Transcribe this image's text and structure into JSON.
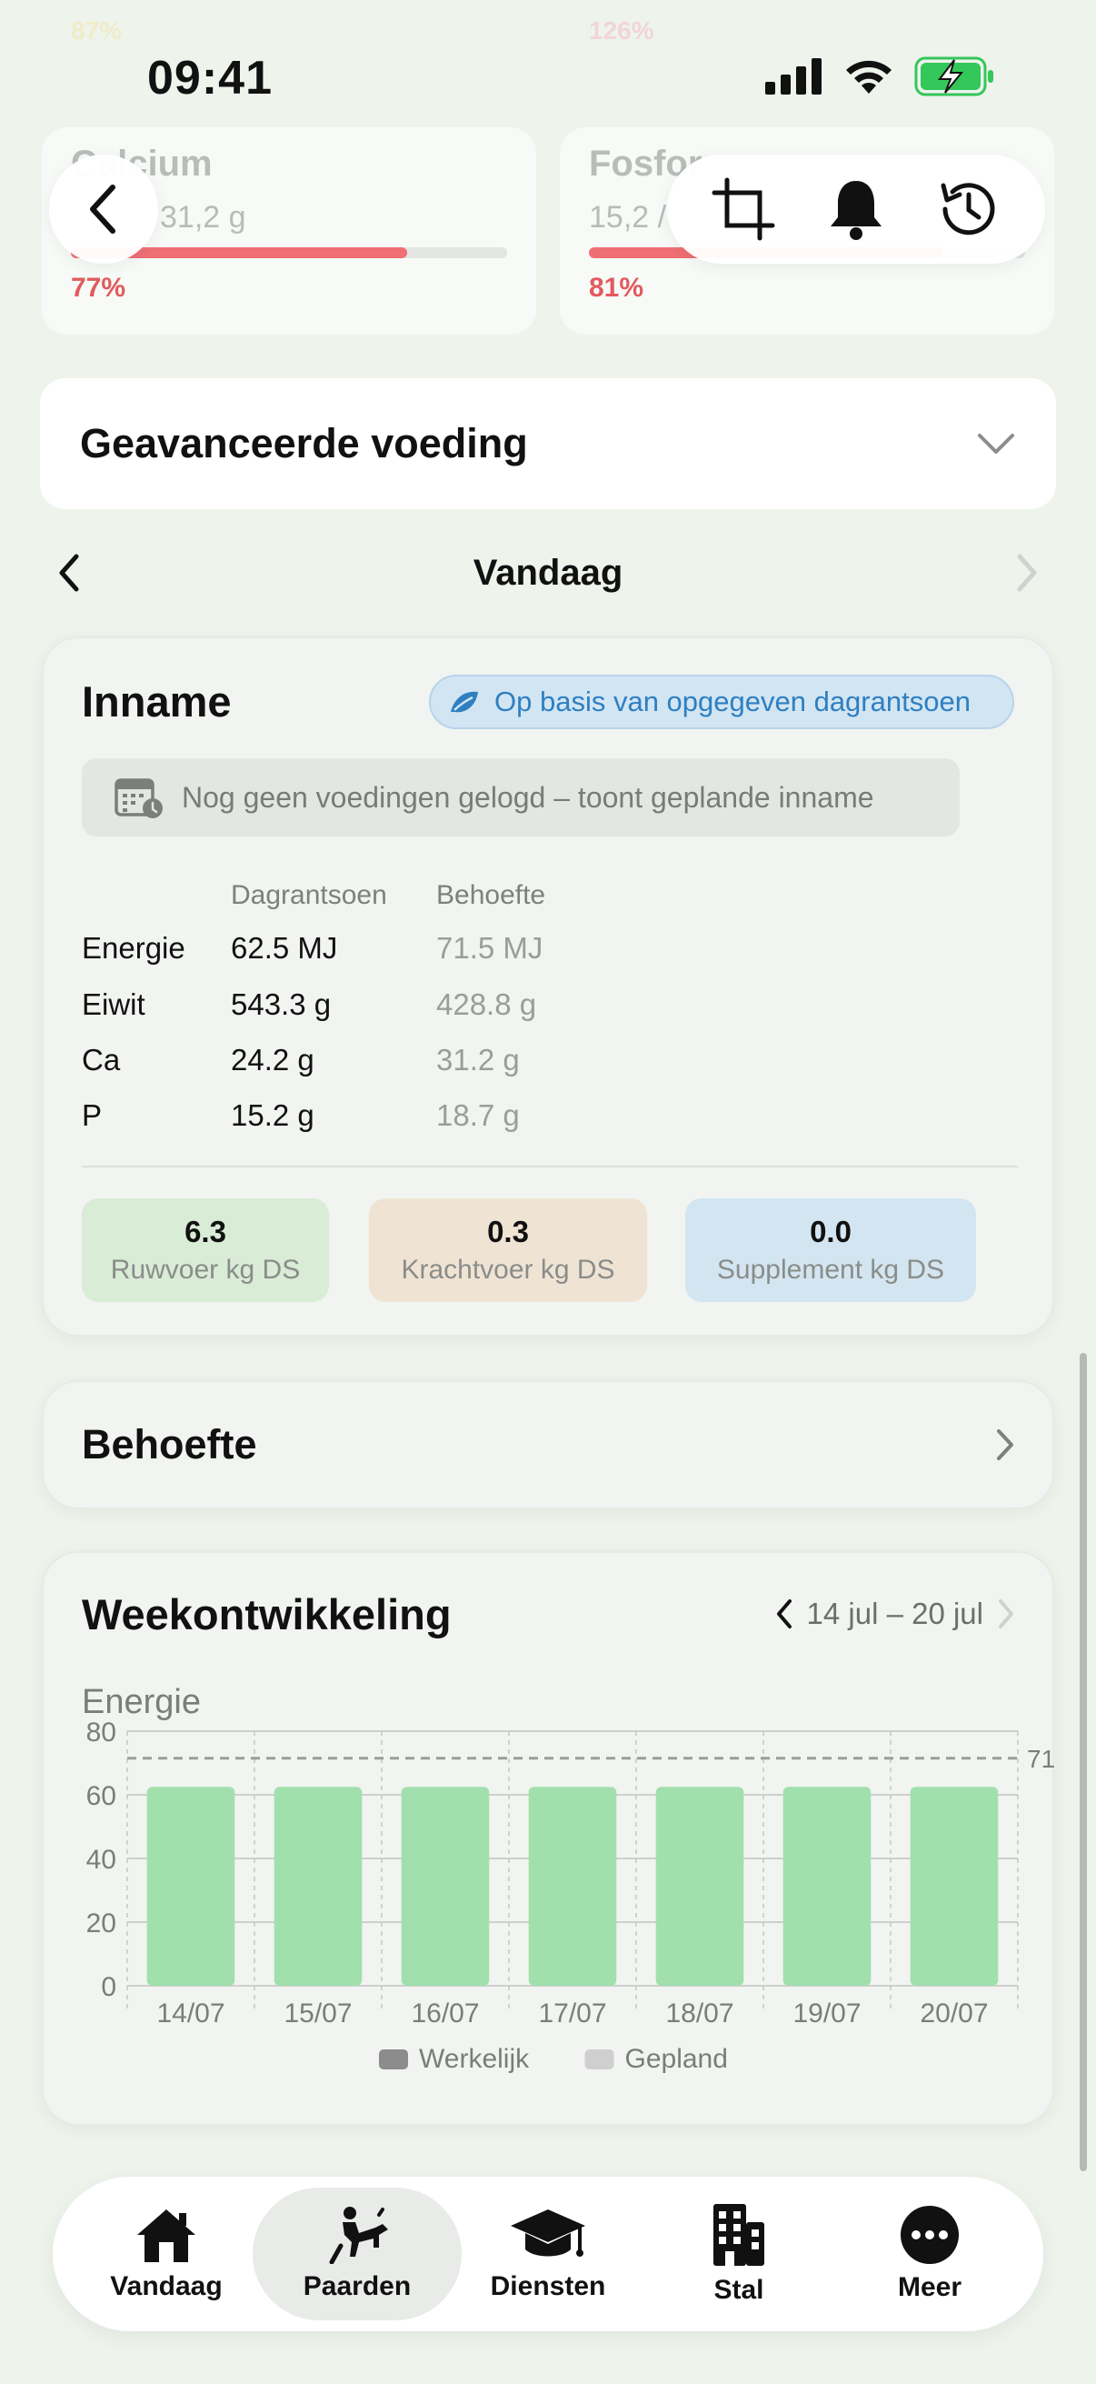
{
  "status": {
    "time": "09:41"
  },
  "top_cards_faded": {
    "left_pct": "87%",
    "right_pct": "126%"
  },
  "nutrients": [
    {
      "name": "Calcium",
      "value": "31,2 g",
      "pct": "77%",
      "fill": 0.77
    },
    {
      "name": "Fosfor",
      "value": "15,2 /",
      "pct": "81%",
      "fill": 0.81
    }
  ],
  "toolbar": {
    "back": "back",
    "crop": "crop",
    "notifications": "notifications",
    "history": "history"
  },
  "advanced": {
    "title": "Geavanceerde voeding"
  },
  "day_nav": {
    "label": "Vandaag"
  },
  "inname": {
    "title": "Inname",
    "badge": "Op basis van opgegeven dagrantsoen",
    "notice": "Nog geen voedingen gelogd – toont geplande inname",
    "columns": [
      "Dagrantsoen",
      "Behoefte"
    ],
    "rows": [
      {
        "label": "Energie",
        "ration": "62.5 MJ",
        "need": "71.5 MJ"
      },
      {
        "label": "Eiwit",
        "ration": "543.3 g",
        "need": "428.8 g"
      },
      {
        "label": "Ca",
        "ration": "24.2 g",
        "need": "31.2 g"
      },
      {
        "label": "P",
        "ration": "15.2 g",
        "need": "18.7 g"
      }
    ],
    "boxes": [
      {
        "value": "6.3",
        "label": "Ruwvoer kg DS",
        "color": "#d9ecd6"
      },
      {
        "value": "0.3",
        "label": "Krachtvoer kg DS",
        "color": "#efe3d4"
      },
      {
        "value": "0.0",
        "label": "Supplement kg DS",
        "color": "#d3e5f0"
      }
    ]
  },
  "behoefte": {
    "title": "Behoefte"
  },
  "week": {
    "title": "Weekontwikkeling",
    "range": "14 jul – 20 jul"
  },
  "chart_data": {
    "type": "bar",
    "title": "Energie",
    "categories": [
      "14/07",
      "15/07",
      "16/07",
      "17/07",
      "18/07",
      "19/07",
      "20/07"
    ],
    "series": [
      {
        "name": "Gepland",
        "values": [
          62.5,
          62.5,
          62.5,
          62.5,
          62.5,
          62.5,
          62.5
        ],
        "color": "#a1e0ad"
      }
    ],
    "reference_line": {
      "value": 71.5,
      "label": "71"
    },
    "ylim": [
      0,
      80
    ],
    "yticks": [
      0,
      20,
      40,
      60,
      80
    ],
    "legend": [
      {
        "name": "Werkelijk",
        "color": "#8c8c8c"
      },
      {
        "name": "Gepland",
        "color": "#cfcfcf"
      }
    ],
    "legend_position": "bottom",
    "grid": true
  },
  "tabs": [
    {
      "label": "Vandaag",
      "active": false
    },
    {
      "label": "Paarden",
      "active": true
    },
    {
      "label": "Diensten",
      "active": false
    },
    {
      "label": "Stal",
      "active": false
    },
    {
      "label": "Meer",
      "active": false
    }
  ]
}
